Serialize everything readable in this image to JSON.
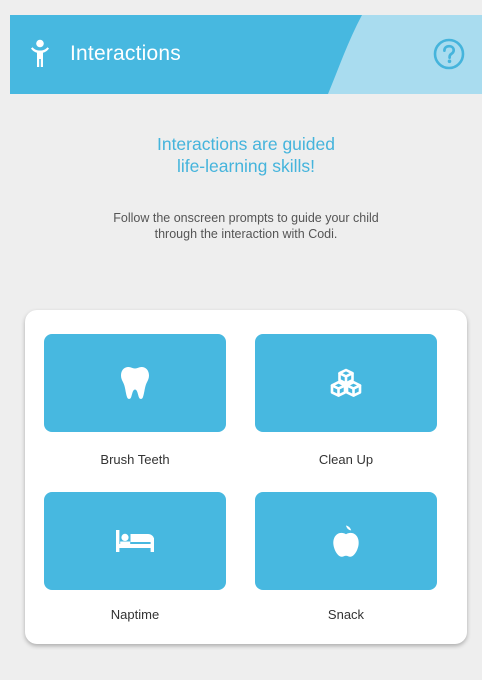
{
  "header": {
    "title": "Interactions",
    "app_icon": "person-icon",
    "help_icon": "question-circle-icon"
  },
  "intro": {
    "headline_line1": "Interactions are guided",
    "headline_line2": "life-learning skills!",
    "subtext_line1": "Follow the onscreen prompts to guide your child",
    "subtext_line2": "through the interaction with Codi."
  },
  "interactions": [
    {
      "label": "Brush Teeth",
      "icon": "tooth-icon"
    },
    {
      "label": "Clean Up",
      "icon": "blocks-icon"
    },
    {
      "label": "Naptime",
      "icon": "bed-icon"
    },
    {
      "label": "Snack",
      "icon": "apple-icon"
    }
  ],
  "colors": {
    "accent": "#47b8e0",
    "header_light": "#a9dcef",
    "headline_text": "#45b4dc",
    "background": "#eeeeee"
  }
}
